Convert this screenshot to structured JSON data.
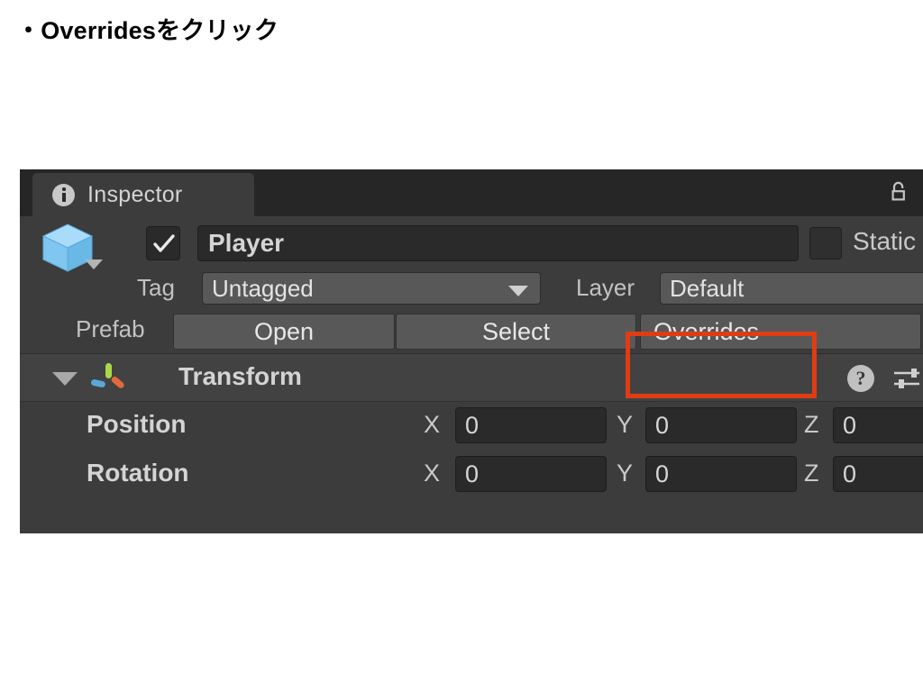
{
  "slide": {
    "heading": "・Overridesをクリック"
  },
  "colors": {
    "annotation": "#e03c14",
    "panel_bg": "#3c3c3c",
    "tabbar_bg": "#262626",
    "field_bg": "#2a2a2a",
    "button_bg": "#585858",
    "prefab_icon_blue": "#7fc7f0"
  },
  "inspector": {
    "tab": {
      "label": "Inspector",
      "icon": "info-icon"
    },
    "lock_icon": "padlock-open-icon",
    "object": {
      "enabled": true,
      "name": "Player",
      "static_label": "Static",
      "static_checked": false,
      "icon": "prefab-cube-icon"
    },
    "tag": {
      "label": "Tag",
      "value": "Untagged"
    },
    "layer": {
      "label": "Layer",
      "value": "Default"
    },
    "prefab": {
      "label": "Prefab",
      "buttons": [
        {
          "label": "Open"
        },
        {
          "label": "Select"
        },
        {
          "label": "Overrides",
          "highlighted": true
        }
      ]
    },
    "components": [
      {
        "title": "Transform",
        "icon": "transform-gizmo-icon",
        "help_icon": "?",
        "settings_icon": "sliders-icon",
        "expanded": true,
        "properties": [
          {
            "label": "Position",
            "axes": [
              {
                "axis": "X",
                "value": "0"
              },
              {
                "axis": "Y",
                "value": "0"
              },
              {
                "axis": "Z",
                "value": "0"
              }
            ]
          },
          {
            "label": "Rotation",
            "axes": [
              {
                "axis": "X",
                "value": "0"
              },
              {
                "axis": "Y",
                "value": "0"
              },
              {
                "axis": "Z",
                "value": "0"
              }
            ]
          }
        ]
      }
    ]
  }
}
